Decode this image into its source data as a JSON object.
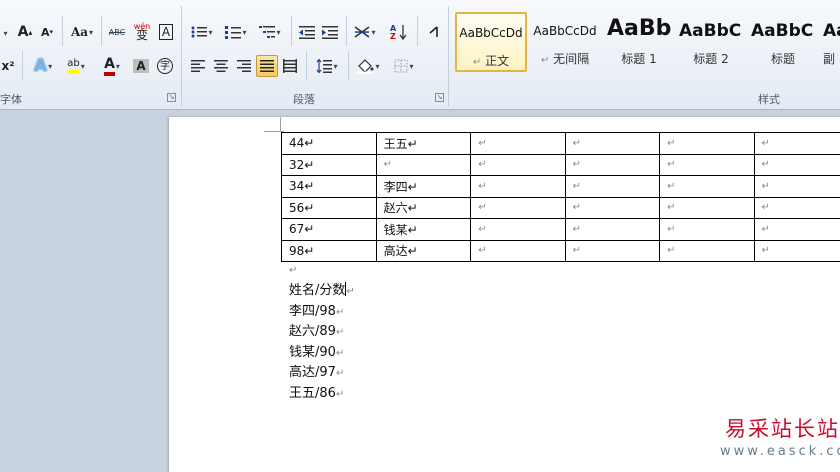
{
  "ribbon": {
    "font_group": {
      "label": "字体",
      "buttons": {
        "grow_font": "A",
        "shrink_font": "A",
        "change_case": "Aa",
        "clear_format": "ABC",
        "pinyin": "wén",
        "pinyin_char": "变",
        "char_border": "A",
        "superscript": "x²",
        "text_effect": "A",
        "highlight": "ab",
        "font_color": "A",
        "char_shading": "A",
        "enclose_char": "字"
      }
    },
    "paragraph_group": {
      "label": "段落"
    },
    "styles_group": {
      "label": "样式",
      "styles": [
        {
          "sample": "AaBbCcDd",
          "name": "正文",
          "selected": true,
          "mark": "↵"
        },
        {
          "sample": "AaBbCcDd",
          "name": "无间隔",
          "selected": false,
          "mark": "↵"
        },
        {
          "sample": "AaBb",
          "name": "标题 1",
          "selected": false,
          "mark": ""
        },
        {
          "sample": "AaBbC",
          "name": "标题 2",
          "selected": false,
          "mark": ""
        },
        {
          "sample": "AaBbC",
          "name": "标题",
          "selected": false,
          "mark": ""
        },
        {
          "sample": "Aa",
          "name": "副",
          "selected": false,
          "mark": ""
        }
      ]
    }
  },
  "document": {
    "table_rows": [
      [
        "44↵",
        "王五↵",
        "↵",
        "↵",
        "↵",
        "↵"
      ],
      [
        "32↵",
        "↵",
        "↵",
        "↵",
        "↵",
        "↵"
      ],
      [
        "34↵",
        "李四↵",
        "↵",
        "↵",
        "↵",
        "↵"
      ],
      [
        "56↵",
        "赵六↵",
        "↵",
        "↵",
        "↵",
        "↵"
      ],
      [
        "67↵",
        "钱某↵",
        "↵",
        "↵",
        "↵",
        "↵"
      ],
      [
        "98↵",
        "高达↵",
        "↵",
        "↵",
        "↵",
        "↵"
      ]
    ],
    "empty_paragraph": "↵",
    "paragraphs": [
      {
        "text": "姓名/分数",
        "mark": "↵"
      },
      {
        "text": "李四/98",
        "mark": "↵"
      },
      {
        "text": "赵六/89",
        "mark": "↵"
      },
      {
        "text": "钱某/90",
        "mark": "↵"
      },
      {
        "text": "高达/97",
        "mark": "↵"
      },
      {
        "text": "王五/86",
        "mark": "↵"
      }
    ]
  },
  "watermark": {
    "title": "易采站长站",
    "url": "www.easck.com"
  },
  "colors": {
    "ribbon_bg": "#e4ebf4",
    "workspace_bg": "#c7d2de",
    "selected_style_border": "#e6b53d",
    "watermark_red": "#c8102e"
  }
}
